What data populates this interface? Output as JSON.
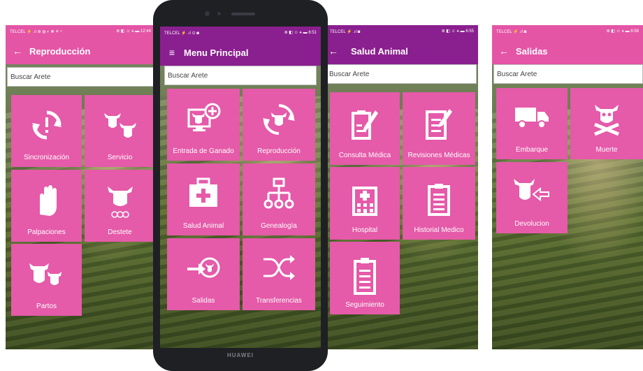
{
  "colors": {
    "pink": "#e55aa9",
    "pink_bar": "#e455a6",
    "purple_bar": "#8a1f8f"
  },
  "screens": {
    "reproduccion": {
      "status_left": "TELCEL ⚡ .ıl ⊛ ◍ ◐ ❋ ⚘ ᵒ",
      "status_right": "⊛ ◧ ☺ ⚹ ▬ 12:44",
      "title": "Reproducción",
      "search_placeholder": "Buscar Arete",
      "tiles": [
        {
          "label": "Sincronización",
          "icon": "sync-alert-icon"
        },
        {
          "label": "Servicio",
          "icon": "cow-pair-icon"
        },
        {
          "label": "Palpaciones",
          "icon": "glove-hand-icon"
        },
        {
          "label": "Destete",
          "icon": "cow-milk-drops-icon"
        },
        {
          "label": "Partos",
          "icon": "cow-calf-icon"
        }
      ]
    },
    "menu": {
      "status_left": "TELCEL ⚡ .ıl ⊙ ◙",
      "status_right": "⊛ ◧ ☺ ⚹ ▬ 6:51",
      "title": "Menu Principal",
      "search_placeholder": "Buscar Arete",
      "tiles": [
        {
          "label": "Entrada de Ganado",
          "icon": "monitor-cow-add-icon"
        },
        {
          "label": "Reproducción",
          "icon": "cow-cycle-icon"
        },
        {
          "label": "Salud Animal",
          "icon": "medical-kit-icon"
        },
        {
          "label": "Genealogía",
          "icon": "tree-diagram-icon"
        },
        {
          "label": "Salidas",
          "icon": "cow-exit-arrow-icon"
        },
        {
          "label": "Transferencias",
          "icon": "shuffle-icon"
        }
      ],
      "brand": "HUAWEI"
    },
    "salud": {
      "status_left": "TELCEL ⚡ .ıl ◙",
      "status_right": "⊛ ◧ ☺ ⚹ ▬ 6:55",
      "title": "Salud Animal",
      "search_placeholder": "Buscar Arete",
      "tiles": [
        {
          "label": "Consulta Médica",
          "icon": "clipboard-edit-icon"
        },
        {
          "label": "Revisiones Médicas",
          "icon": "document-edit-icon"
        },
        {
          "label": "Hospital",
          "icon": "hospital-icon"
        },
        {
          "label": "Historial Medico",
          "icon": "clipboard-list-icon"
        },
        {
          "label": "Seguimiento",
          "icon": "clipboard-lines-icon"
        }
      ]
    },
    "salidas": {
      "status_left": "TELCEL ⚡ .ıl ◙",
      "status_right": "⊛ ◧ ☺ ⚹ ▬ 6:58",
      "title": "Salidas",
      "search_placeholder": "Buscar Arete",
      "tiles": [
        {
          "label": "Embarque",
          "icon": "truck-icon"
        },
        {
          "label": "Muerte",
          "icon": "cow-skull-icon"
        },
        {
          "label": "Devolucion",
          "icon": "cow-return-icon"
        }
      ]
    }
  }
}
